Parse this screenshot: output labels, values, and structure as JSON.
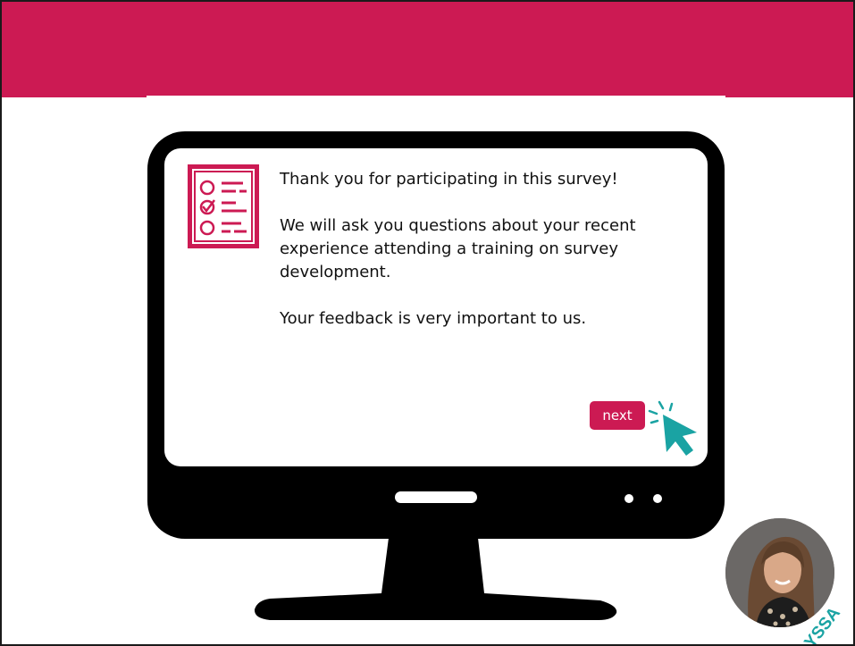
{
  "colors": {
    "brand": "#cc1a53",
    "teal_accent": "#1aa3a3",
    "monitor": "#000000"
  },
  "survey": {
    "paragraphs": [
      "Thank you for participating in this survey!",
      "We will ask you questions about your recent experience attending a training on survey development.",
      "Your feedback is very important to us."
    ],
    "next_label": "next"
  },
  "icons": {
    "survey": "checklist-icon",
    "cursor": "click-cursor-icon"
  },
  "presenter": {
    "logo_text": "LYSSA"
  }
}
